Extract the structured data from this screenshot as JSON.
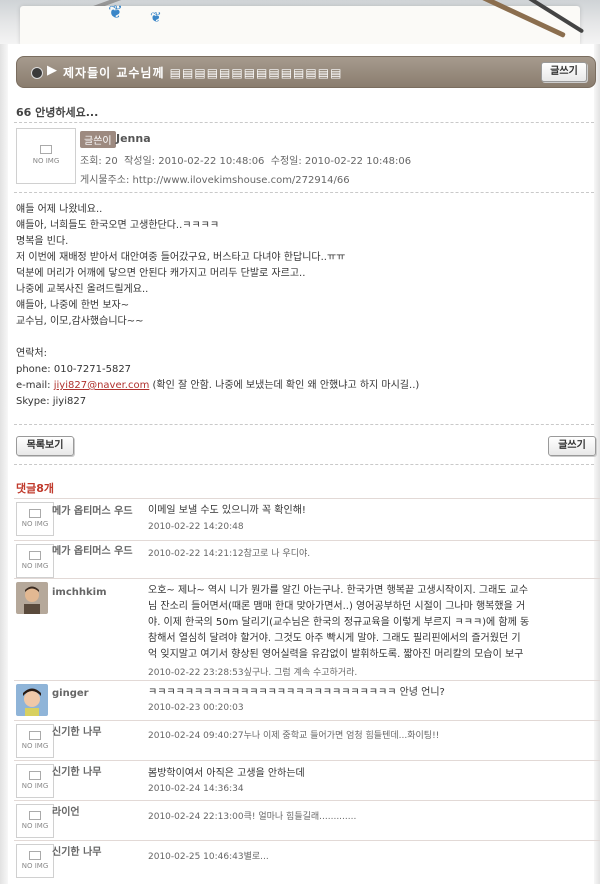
{
  "board": {
    "title": "제자들이 교수님께 ▤▤▤▤▤▤▤▤▤▤▤▤▤▤",
    "write_label": "글쓰기"
  },
  "post": {
    "title": "66 안녕하세요...",
    "noimg": "NO IMG",
    "writer_badge": "글쓴이",
    "writer": "Jenna",
    "views_label": "조회",
    "views": "20",
    "created": "작성일: 2010-02-22 10:48:06",
    "modified": "수정일: 2010-02-22 10:48:06",
    "address": "게시물주소: http://www.ilovekimshouse.com/272914/66",
    "lines": [
      "얘들 어제 나왔네요..",
      "얘들아, 너희들도 한국오면 고생한단다..ㅋㅋㅋㅋ",
      "명복을 빈다.",
      "저 이번에 재배정 받아서 대안여중 들어갔구요, 버스타고 다녀야 한답니다..ㅠㅠ",
      "덕분에 머리가 어깨에 닿으면 안된다 캐가지고 머리두 단발로 자르고..",
      "나중에 교복사진 올려드릴게요..",
      "얘들아, 나중에 한번 보자~",
      "교수님, 이모,감사했습니다~~",
      "",
      "연락처:",
      "phone: 010-7271-5827"
    ],
    "email_prefix": "e-mail: ",
    "email": "jiyi827@naver.com",
    "email_note": " (확인 잘 안함. 나중에 보냈는데 확인 왜 안했냐고 하지 마시길..)",
    "skype": "Skype: jiyi827",
    "list_label": "목록보기",
    "write_label": "글쓰기"
  },
  "comments": {
    "heading": "댓글8개",
    "items": [
      {
        "name": "메가 옵티머스 우드",
        "text": [
          "이메일 보낼 수도 있으니까 꼭 확인해!"
        ],
        "date": "2010-02-22 14:20:48"
      },
      {
        "name": "메가 옵티머스 우드",
        "text": [],
        "date": "2010-02-22 14:21:12참고로 나 우디야."
      },
      {
        "name": "imchhkim",
        "text": [
          "오호~ 제나~ 역시 니가 뭔가를 알긴 아는구나. 한국가면 행복끝 고생시작이지. 그래도 교수",
          "님 잔소리 들어면서(때론 맴매 한대 맞아가면서..) 영어공부하던 시절이 그나마 행복했을 거",
          "야. 이제 한국의 50m 달리기(교수님은 한국의 정규교육을 이렇게 부르지 ㅋㅋㅋ)에 함께 동",
          "참해서 열심히 달려야 할거야. 그것도 아주 빡시게 말야. 그래도 필리핀에서의 즐거웠던 기",
          "억 잊지말고 여기서 향상된 영어실력을 유감없이 발휘하도록. 짧아진 머리칼의 모습이 보구"
        ],
        "date": "2010-02-22 23:28:53싶구나. 그럼 계속 수고하거라."
      },
      {
        "name": "ginger",
        "text": [
          "ㅋㅋㅋㅋㅋㅋㅋㅋㅋㅋㅋㅋㅋㅋㅋㅋㅋㅋㅋㅋㅋㅋㅋㅋㅋㅋㅋ 안녕 언니?"
        ],
        "date": "2010-02-23 00:20:03"
      },
      {
        "name": "신기한 나무",
        "text": [],
        "date": "2010-02-24 09:40:27누나 이제 중학교 들어가면 엄청 힘들텐데...화이팅!!"
      },
      {
        "name": "신기한 나무",
        "text": [
          "봄방학이여서 아직은 고생을 안하는데"
        ],
        "date": "2010-02-24 14:36:34"
      },
      {
        "name": "라이언",
        "text": [],
        "date": "2010-02-24 22:13:00큭! 얼마나 힘들길래............."
      },
      {
        "name": "신기한 나무",
        "text": [],
        "date": "2010-02-25 10:46:43별로..."
      }
    ]
  }
}
